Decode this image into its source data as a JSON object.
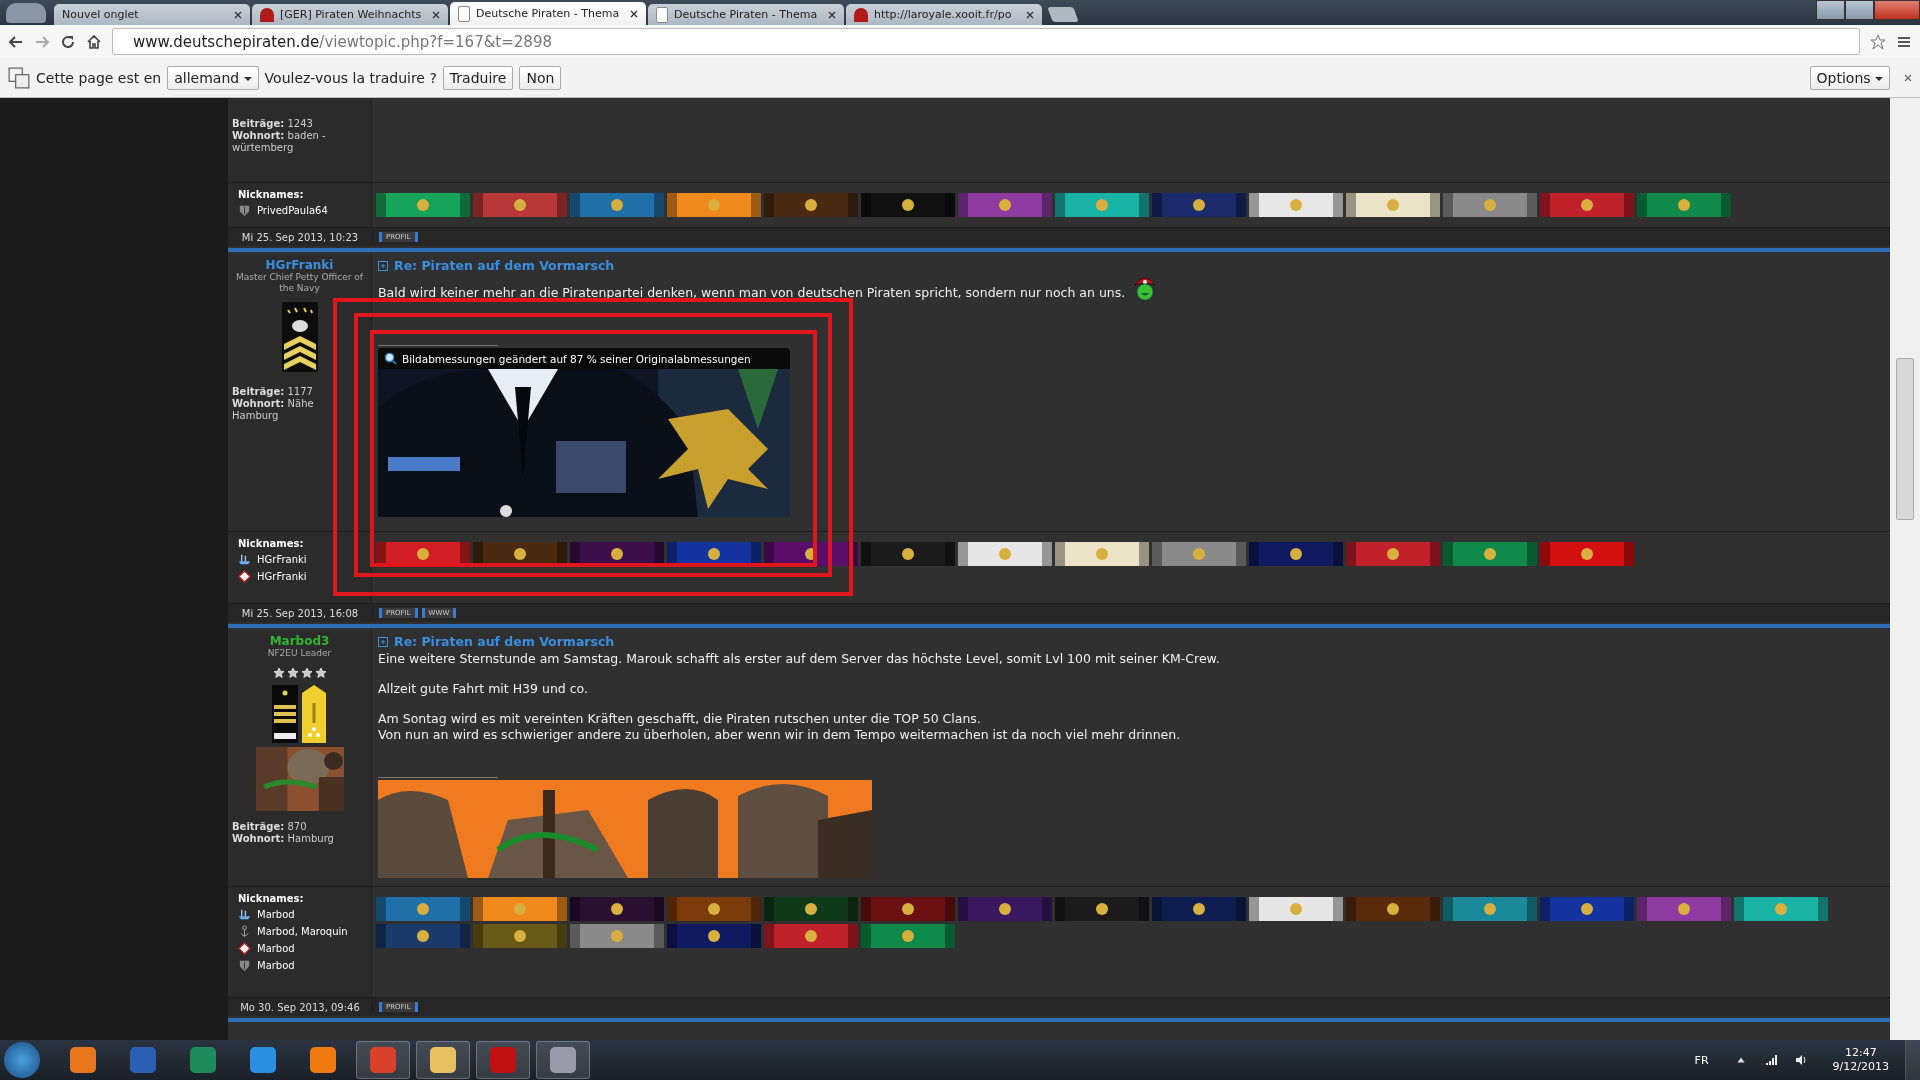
{
  "browser": {
    "tabs": [
      {
        "title": "Nouvel onglet",
        "selected": false
      },
      {
        "title": "[GER] Piraten Weihnachts",
        "selected": false
      },
      {
        "title": "Deutsche Piraten - Thema",
        "selected": true
      },
      {
        "title": "Deutsche Piraten - Thema",
        "selected": false
      },
      {
        "title": "http://laroyale.xooit.fr/po",
        "selected": false
      }
    ],
    "url_host": "www.deutschepiraten.de",
    "url_path": "/viewtopic.php?f=167&t=2898"
  },
  "translate_bar": {
    "prompt": "Cette page est en",
    "language": "allemand",
    "question": "Voulez-vous la traduire ?",
    "translate": "Traduire",
    "decline": "Non",
    "options": "Options"
  },
  "posts": [
    {
      "stats": [
        {
          "label": "Beiträge:",
          "value": "1243"
        },
        {
          "label": "Wohnort:",
          "value": "baden - würtemberg"
        }
      ],
      "nicknames_label": "Nicknames:",
      "nicknames": [
        {
          "name": "PrivedPaula64",
          "kind": "tank"
        }
      ],
      "ribbons": [
        {
          "color": "#17a35a"
        },
        {
          "color": "#b8383a"
        },
        {
          "color": "#1f6fa8"
        },
        {
          "color": "#f08a1c"
        },
        {
          "color": "#4a2a10"
        },
        {
          "color": "#111111"
        },
        {
          "color": "#8e3aa0"
        },
        {
          "color": "#19b3a6"
        },
        {
          "color": "#1a2a6a"
        },
        {
          "color": "#e8e8e8"
        },
        {
          "color": "#ece4c8"
        },
        {
          "color": "#8a8a8a"
        },
        {
          "color": "#c0202a"
        },
        {
          "color": "#0f8a4a"
        }
      ],
      "date": "Mi 25. Sep 2013, 10:23",
      "buttons": [
        "PROFIL"
      ]
    },
    {
      "author": "HGrFranki",
      "color": "#3a8ee0",
      "rank": "Master Chief Petty Officer of the Navy",
      "stats": [
        {
          "label": "Beiträge:",
          "value": "1177"
        },
        {
          "label": "Wohnort:",
          "value": "Nähe Hamburg"
        }
      ],
      "subject": "Re: Piraten auf dem Vormarsch",
      "paragraphs": [
        {
          "lines": [
            "Bald wird keiner mehr an die Piratenpartei denken, wenn man von deutschen Piraten spricht, sondern nur noch an uns."
          ],
          "smiley": true
        }
      ],
      "signature": {
        "kind": "awards",
        "caption": "Bildabmessungen geändert auf 87 % seiner Originalabmessungen"
      },
      "nicknames_label": "Nicknames:",
      "nicknames": [
        {
          "name": "HGrFranki",
          "kind": "ship"
        },
        {
          "name": "HGrFranki",
          "kind": "flag"
        }
      ],
      "ribbons": [
        {
          "color": "#d01e24"
        },
        {
          "color": "#4a2a10"
        },
        {
          "color": "#3d0f4a"
        },
        {
          "color": "#1432a0"
        },
        {
          "color": "#5a0e6a"
        },
        {
          "color": "#1b1b1b"
        },
        {
          "color": "#e6e6e6"
        },
        {
          "color": "#ece4c8"
        },
        {
          "color": "#8a8a8a"
        },
        {
          "color": "#101a60"
        },
        {
          "color": "#c0202a"
        },
        {
          "color": "#0f8a4a"
        },
        {
          "color": "#d40f0f"
        }
      ],
      "date": "Mi 25. Sep 2013, 16:08",
      "buttons": [
        "PROFIL",
        "WWW"
      ]
    },
    {
      "author": "Marbod3",
      "color": "#2fb52f",
      "rank": "NF2EU Leader",
      "stars": 4,
      "stats": [
        {
          "label": "Beiträge:",
          "value": "870"
        },
        {
          "label": "Wohnort:",
          "value": "Hamburg"
        }
      ],
      "subject": "Re: Piraten auf dem Vormarsch",
      "paragraphs": [
        {
          "lines": [
            "Eine weitere Sternstunde am Samstag. Marouk schafft als erster auf dem Server das höchste Level, somit Lvl 100 mit seiner KM-Crew."
          ],
          "smiley": false
        },
        {
          "lines": [
            "Allzeit gute Fahrt mit H39 und co."
          ],
          "smiley": false
        },
        {
          "lines": [
            "Am Sontag wird es mit vereinten Kräften geschafft, die Piraten rutschen unter die TOP 50 Clans.",
            "Von nun an wird es schwieriger andere zu überholen, aber wenn wir in dem Tempo weitermachen ist da noch viel mehr drinnen."
          ],
          "smiley": false
        }
      ],
      "signature": {
        "kind": "warriors"
      },
      "nicknames_label": "Nicknames:",
      "nicknames": [
        {
          "name": "Marbod",
          "kind": "ship"
        },
        {
          "name": "Marbod, Maroquin",
          "kind": "anchor"
        },
        {
          "name": "Marbod",
          "kind": "flag"
        },
        {
          "name": "Marbod",
          "kind": "tank"
        }
      ],
      "ribbons": [
        {
          "color": "#1f6fa8"
        },
        {
          "color": "#f08a1c"
        },
        {
          "color": "#2a1030"
        },
        {
          "color": "#7a3a0a"
        },
        {
          "color": "#0e3a1a"
        },
        {
          "color": "#6a1010"
        },
        {
          "color": "#3a1860"
        },
        {
          "color": "#1b1b1b"
        },
        {
          "color": "#0e1e50"
        },
        {
          "color": "#e6e6e6"
        },
        {
          "color": "#5a2a0a"
        },
        {
          "color": "#1a8a9a"
        },
        {
          "color": "#1432a0"
        },
        {
          "color": "#8e3aa0"
        },
        {
          "color": "#19b3a6"
        },
        {
          "color": "#1a3a6a"
        },
        {
          "color": "#6a5a1a"
        },
        {
          "color": "#8a8a8a"
        },
        {
          "color": "#101a60"
        },
        {
          "color": "#c0202a"
        },
        {
          "color": "#0f8a4a"
        }
      ],
      "date": "Mo 30. Sep 2013, 09:46",
      "buttons": [
        "PROFIL"
      ]
    }
  ],
  "taskbar": {
    "language": "FR",
    "time": "12:47",
    "date": "9/12/2013",
    "apps": [
      {
        "kind": "media"
      },
      {
        "kind": "doc"
      },
      {
        "kind": "sheet"
      },
      {
        "kind": "globe"
      },
      {
        "kind": "cone"
      },
      {
        "kind": "browser"
      },
      {
        "kind": "folder"
      },
      {
        "kind": "pdf"
      },
      {
        "kind": "paint"
      }
    ]
  }
}
